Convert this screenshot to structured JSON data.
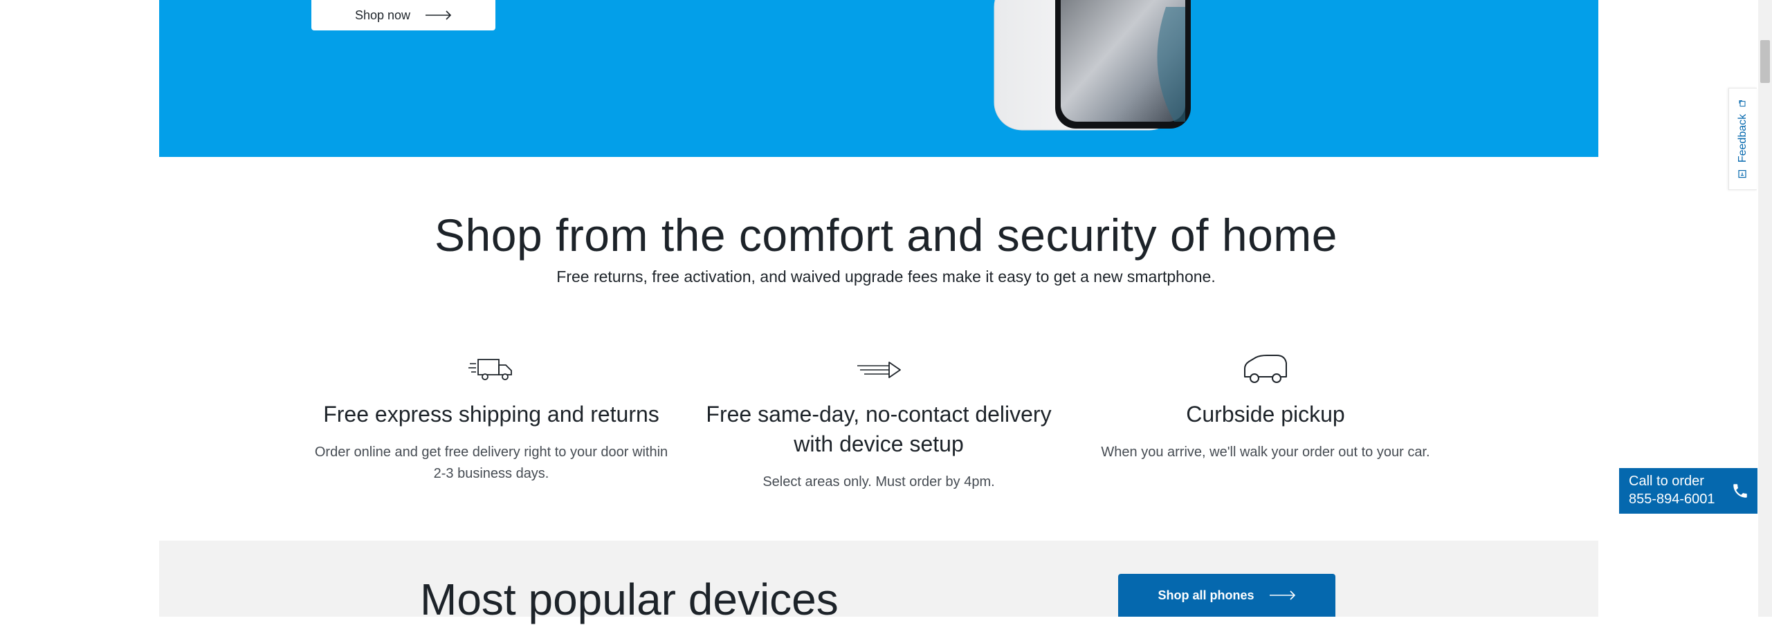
{
  "hero": {
    "shop_now_label": "Shop now",
    "background_color": "#039fe9"
  },
  "section": {
    "title": "Shop from the comfort and security of home",
    "subtitle": "Free returns, free activation, and waived upgrade fees make it easy to get a new smartphone."
  },
  "features": [
    {
      "icon": "delivery-truck-icon",
      "title": "Free express shipping and returns",
      "description": "Order online and get free delivery right to your door within 2-3 business days."
    },
    {
      "icon": "fast-arrow-icon",
      "title": "Free same-day, no-contact delivery with device setup",
      "description": "Select areas only. Must order by 4pm."
    },
    {
      "icon": "car-icon",
      "title": "Curbside pickup",
      "description": "When you arrive, we'll walk your order out to your car."
    }
  ],
  "popular": {
    "title": "Most popular devices",
    "shop_all_label": "Shop all phones"
  },
  "feedback": {
    "label": "Feedback"
  },
  "call": {
    "line1": "Call to order",
    "number": "855-894-6001"
  },
  "colors": {
    "accent_blue": "#0568ae",
    "hero_blue": "#039fe9",
    "text_dark": "#1d2329"
  }
}
